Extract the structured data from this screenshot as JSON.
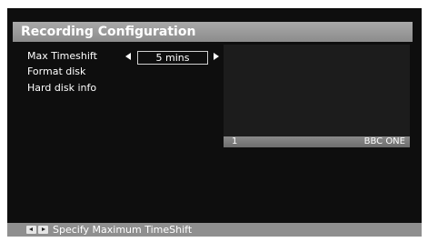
{
  "title": "Recording Configuration",
  "menu": {
    "max_timeshift_label": "Max Timeshift",
    "max_timeshift_value": "5 mins",
    "format_disk_label": "Format disk",
    "hard_disk_info_label": "Hard disk info"
  },
  "preview": {
    "channel_number": "1",
    "channel_name": "BBC ONE"
  },
  "footer": {
    "hint": "Specify Maximum TimeShift",
    "keys": [
      "arrow-left-key-icon",
      "arrow-right-key-icon"
    ]
  },
  "colors": {
    "background": "#0e0e0e",
    "title_bar": "#9a9a9a",
    "footer_bar": "#8f8f8f",
    "text": "#ffffff"
  }
}
